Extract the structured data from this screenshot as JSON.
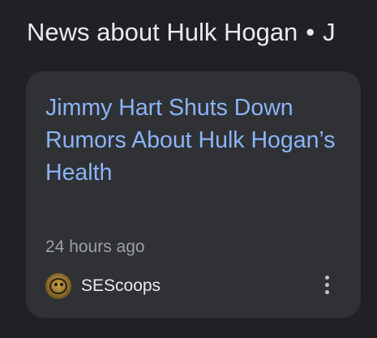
{
  "section": {
    "title": "News about Hulk Hogan",
    "separator": "•",
    "trailing": "J"
  },
  "card": {
    "headline": "Jimmy Hart Shuts Down Rumors About Hulk Hogan’s Health",
    "timestamp": "24 hours ago",
    "source": {
      "name": "SEScoops",
      "logo_icon": "sescoops-logo-icon"
    },
    "more_icon": "more-vert-icon"
  },
  "colors": {
    "background": "#202124",
    "card": "#303134",
    "headline": "#8ab4f8",
    "text": "#e8eaed",
    "muted": "#9aa0a6"
  }
}
